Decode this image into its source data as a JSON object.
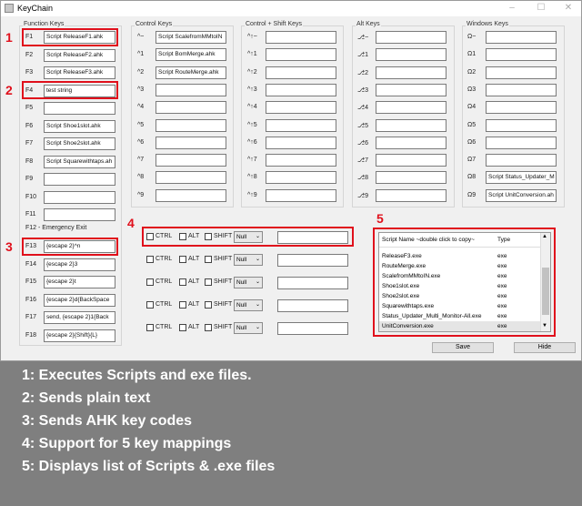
{
  "window": {
    "title": "KeyChain",
    "controls": [
      "–",
      "☐",
      "✕"
    ]
  },
  "function_keys": {
    "group_label": "Function Keys",
    "rows": [
      {
        "label": "F1",
        "value": "Script ReleaseF1.ahk"
      },
      {
        "label": "F2",
        "value": "Script ReleaseF2.ahk"
      },
      {
        "label": "F3",
        "value": "Script ReleaseF3.ahk"
      },
      {
        "label": "F4",
        "value": "test string"
      },
      {
        "label": "F5",
        "value": ""
      },
      {
        "label": "F6",
        "value": "Script Shoe1slot.ahk"
      },
      {
        "label": "F7",
        "value": "Script Shoe2slot.ahk"
      },
      {
        "label": "F8",
        "value": "Script Squarewithtaps.ah"
      },
      {
        "label": "F9",
        "value": ""
      },
      {
        "label": "F10",
        "value": ""
      },
      {
        "label": "F11",
        "value": ""
      }
    ],
    "emergency_label": "F12  -  Emergency Exit",
    "rows2": [
      {
        "label": "F13",
        "value": "{escape 2}^n"
      },
      {
        "label": "F14",
        "value": "{escape 2}3"
      },
      {
        "label": "F15",
        "value": "{escape 2}t"
      },
      {
        "label": "F16",
        "value": "{escape 2}d{BackSpace"
      },
      {
        "label": "F17",
        "value": "send, {escape 2}1{Back"
      },
      {
        "label": "F18",
        "value": "{escape 2}{Shift}{L}"
      }
    ]
  },
  "control_keys": {
    "group_label": "Control Keys",
    "rows": [
      {
        "label": "^~",
        "value": "Script ScalefromMMtoIN"
      },
      {
        "label": "^1",
        "value": "Script BomMerge.ahk"
      },
      {
        "label": "^2",
        "value": "Script RouteMerge.ahk"
      },
      {
        "label": "^3",
        "value": ""
      },
      {
        "label": "^4",
        "value": ""
      },
      {
        "label": "^5",
        "value": ""
      },
      {
        "label": "^6",
        "value": ""
      },
      {
        "label": "^7",
        "value": ""
      },
      {
        "label": "^8",
        "value": ""
      },
      {
        "label": "^9",
        "value": ""
      }
    ]
  },
  "control_shift_keys": {
    "group_label": "Control + Shift Keys",
    "rows": [
      {
        "label": "^↑~",
        "value": ""
      },
      {
        "label": "^↑1",
        "value": ""
      },
      {
        "label": "^↑2",
        "value": ""
      },
      {
        "label": "^↑3",
        "value": ""
      },
      {
        "label": "^↑4",
        "value": ""
      },
      {
        "label": "^↑5",
        "value": ""
      },
      {
        "label": "^↑6",
        "value": ""
      },
      {
        "label": "^↑7",
        "value": ""
      },
      {
        "label": "^↑8",
        "value": ""
      },
      {
        "label": "^↑9",
        "value": ""
      }
    ]
  },
  "alt_keys": {
    "group_label": "Alt Keys",
    "rows": [
      {
        "label": "⎇~",
        "value": ""
      },
      {
        "label": "⎇1",
        "value": ""
      },
      {
        "label": "⎇2",
        "value": ""
      },
      {
        "label": "⎇3",
        "value": ""
      },
      {
        "label": "⎇4",
        "value": ""
      },
      {
        "label": "⎇5",
        "value": ""
      },
      {
        "label": "⎇6",
        "value": ""
      },
      {
        "label": "⎇7",
        "value": ""
      },
      {
        "label": "⎇8",
        "value": ""
      },
      {
        "label": "⎇9",
        "value": ""
      }
    ]
  },
  "windows_keys": {
    "group_label": "Windows Keys",
    "rows": [
      {
        "label": "Ω~",
        "value": ""
      },
      {
        "label": "Ω1",
        "value": ""
      },
      {
        "label": "Ω2",
        "value": ""
      },
      {
        "label": "Ω3",
        "value": ""
      },
      {
        "label": "Ω4",
        "value": ""
      },
      {
        "label": "Ω5",
        "value": ""
      },
      {
        "label": "Ω6",
        "value": ""
      },
      {
        "label": "Ω7",
        "value": ""
      },
      {
        "label": "Ω8",
        "value": "Script Status_Updater_M"
      },
      {
        "label": "Ω9",
        "value": "Script UnitConversion.ah"
      }
    ]
  },
  "custom_mappings": {
    "ctrl_label": "CTRL",
    "alt_label": "ALT",
    "shift_label": "SHIFT",
    "rows": [
      {
        "key": "Null",
        "value": ""
      },
      {
        "key": "Null",
        "value": ""
      },
      {
        "key": "Null",
        "value": ""
      },
      {
        "key": "Null",
        "value": ""
      },
      {
        "key": "Null",
        "value": ""
      }
    ]
  },
  "script_list": {
    "col_name": "Script Name   ~double click to copy~",
    "col_type": "Type",
    "items": [
      {
        "name": "ReleaseF3.exe",
        "type": "exe"
      },
      {
        "name": "RouteMerge.exe",
        "type": "exe"
      },
      {
        "name": "ScalefromMMtoIN.exe",
        "type": "exe"
      },
      {
        "name": "Shoe1slot.exe",
        "type": "exe"
      },
      {
        "name": "Shoe2slot.exe",
        "type": "exe"
      },
      {
        "name": "Squarewithtaps.exe",
        "type": "exe"
      },
      {
        "name": "Status_Updater_Multi_Monitor-All.exe",
        "type": "exe"
      },
      {
        "name": "UnitConversion.exe",
        "type": "exe"
      }
    ]
  },
  "buttons": {
    "save": "Save",
    "hide": "Hide"
  },
  "callouts": [
    "1",
    "2",
    "3",
    "4",
    "5"
  ],
  "notes": [
    "1: Executes Scripts and exe files.",
    "2: Sends plain text",
    "3: Sends AHK key codes",
    "4: Support for 5 key mappings",
    "5: Displays list of Scripts & .exe files"
  ],
  "colors": {
    "callout_red": "#e0101c",
    "background_gray": "#7f7f7f"
  }
}
